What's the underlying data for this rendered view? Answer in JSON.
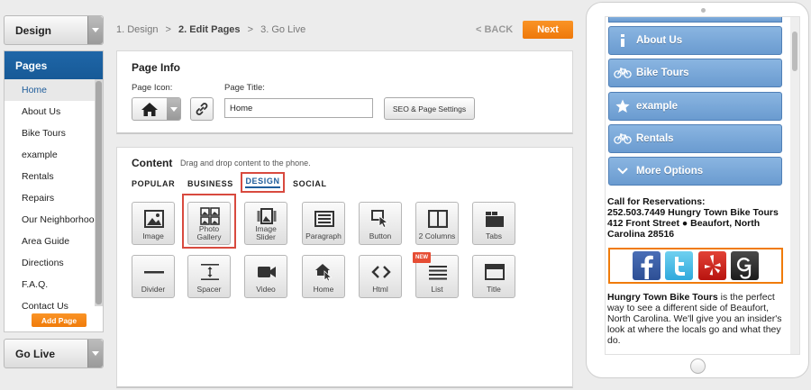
{
  "sidebar": {
    "design_label": "Design",
    "pages_header": "Pages",
    "pages": [
      "Home",
      "About Us",
      "Bike Tours",
      "example",
      "Rentals",
      "Repairs",
      "Our Neighborhood",
      "Area Guide",
      "Directions",
      "F.A.Q.",
      "Contact Us"
    ],
    "active_page": "Home",
    "add_page_label": "Add Page",
    "golive_label": "Go Live"
  },
  "steps": {
    "step1": "1. Design",
    "step2": "2. Edit Pages",
    "step3": "3. Go Live",
    "sep": ">",
    "back_label": "< BACK",
    "next_label": "Next"
  },
  "page_info": {
    "title": "Page Info",
    "icon_label": "Page Icon:",
    "title_label": "Page Title:",
    "page_title_value": "Home",
    "seo_label": "SEO & Page Settings"
  },
  "content": {
    "title": "Content",
    "hint": "Drag and drop content to the phone.",
    "tabs": [
      "POPULAR",
      "BUSINESS",
      "DESIGN",
      "SOCIAL"
    ],
    "active_tab": "DESIGN",
    "tiles_row1": [
      "Image",
      "Photo Gallery",
      "Image Slider",
      "Paragraph",
      "Button",
      "2 Columns",
      "Tabs"
    ],
    "tiles_row2": [
      "Divider",
      "Spacer",
      "Video",
      "Home",
      "Html",
      "List",
      "Title"
    ],
    "new_badge": "NEW"
  },
  "phone": {
    "nav": [
      "About Us",
      "Bike Tours",
      "example",
      "Rentals",
      "More Options"
    ],
    "nav_icons": [
      "info-icon",
      "bicycle-icon",
      "star-icon",
      "bicycle-icon",
      "chevron-down-icon"
    ],
    "contact_line1": "Call for Reservations:",
    "contact_line2": "252.503.7449  Hungry Town Bike Tours 412 Front Street  ● Beaufort, North Carolina 28516",
    "desc_bold": "Hungry Town Bike Tours",
    "desc_rest": " is the perfect way to see a different side of Beaufort, North Carolina. We'll give you an insider's look at where the locals go and what they do.",
    "social": [
      "facebook-icon",
      "twitter-icon",
      "yelp-icon",
      "google-icon"
    ]
  },
  "colors": {
    "accent_orange": "#f07b0a",
    "pages_blue": "#1f66a8",
    "nav_blue": "#7aa8d9",
    "highlight_red": "#d84a3f"
  }
}
